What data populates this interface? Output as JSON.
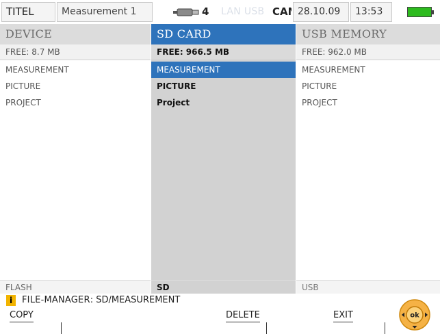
{
  "status_bar": {
    "title": "TITEL",
    "measurement": "Measurement 1",
    "usb_device_count": "4",
    "interfaces_inactive": "LAN USB",
    "interface_active": "CAN",
    "date": "28.10.09",
    "time": "13:53",
    "battery_color": "#2dbb1e"
  },
  "columns": {
    "device": {
      "header": "DEVICE",
      "free": "FREE: 8.7 MB",
      "items": [
        "MEASUREMENT",
        "PICTURE",
        "PROJECT"
      ],
      "storage_label": "FLASH"
    },
    "sd": {
      "header": "SD CARD",
      "free": "FREE: 966.5 MB",
      "items": [
        "MEASUREMENT",
        "PICTURE",
        "Project"
      ],
      "selected_item": "MEASUREMENT",
      "storage_label": "SD"
    },
    "usb": {
      "header": "USB MEMORY",
      "free": "FREE: 962.0 MB",
      "items": [
        "MEASUREMENT",
        "PICTURE",
        "PROJECT"
      ],
      "storage_label": "USB"
    }
  },
  "info": {
    "icon": "i",
    "key": "FILE-MANAGER",
    "separator": ":",
    "path": "SD/MEASUREMENT"
  },
  "softkeys": {
    "copy": "COPY",
    "delete": "DELETE",
    "exit": "EXIT"
  },
  "nav": {
    "center_label": "ok"
  },
  "colors": {
    "accent_blue": "#2e73bb",
    "nav_orange": "#f5a623",
    "info_yellow": "#f2b400"
  }
}
